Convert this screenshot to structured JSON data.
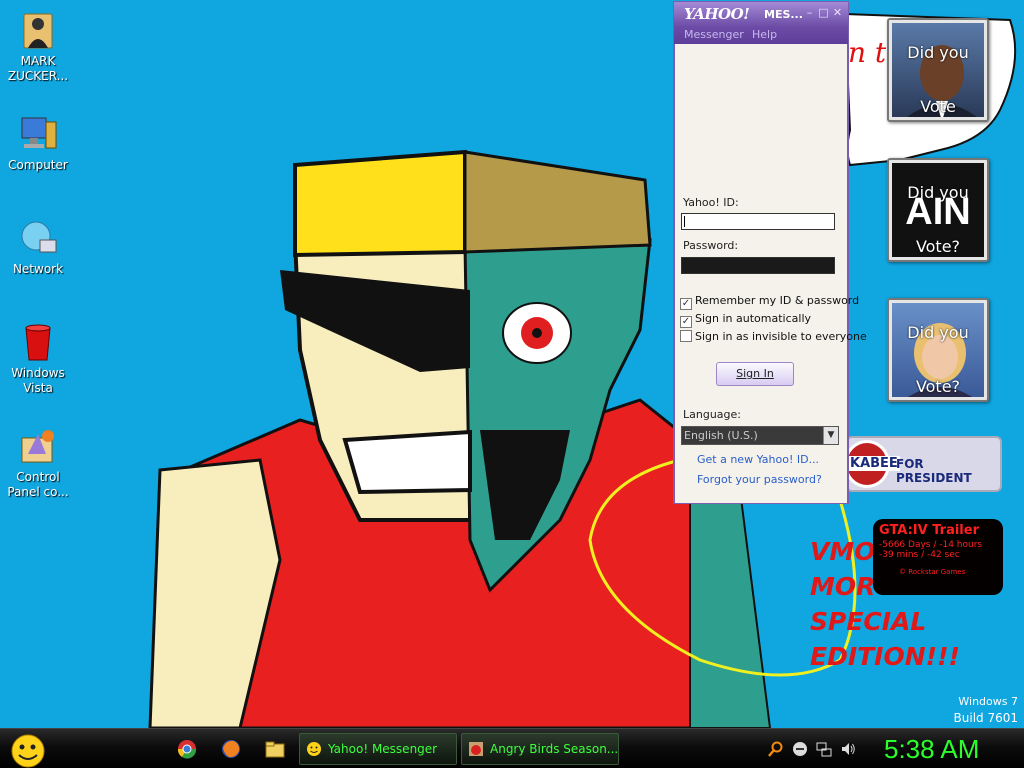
{
  "desktop": {
    "icons": [
      {
        "label_line1": "MARK",
        "label_line2": "ZUCKER..."
      },
      {
        "label_line1": "Computer",
        "label_line2": ""
      },
      {
        "label_line1": "Network",
        "label_line2": ""
      },
      {
        "label_line1": "Windows",
        "label_line2": "Vista"
      },
      {
        "label_line1": "Control",
        "label_line2": "Panel co..."
      }
    ],
    "wallpaper_text": {
      "bubble_text": "n t",
      "vmod_lines": [
        "VMO",
        "MOR",
        "SPECIAL",
        "EDITION!!!"
      ]
    },
    "gadgets": {
      "photos": [
        {
          "line1": "Did you",
          "line2": "Vote"
        },
        {
          "line1": "Did you",
          "big": "AIN",
          "line2": "Vote?"
        },
        {
          "line1": "Did you",
          "line2": "Vote?"
        }
      ],
      "banner": {
        "name": "KABEE",
        "text": "FOR PRESIDENT"
      },
      "gta": {
        "title": "GTA:IV Trailer",
        "line1": "-5666 Days / -14 hours",
        "line2": "-39 mins / -42 sec",
        "footer": "© Rockstar Games"
      }
    },
    "build": {
      "line1": "Windows 7",
      "line2": "Build 7601"
    }
  },
  "messenger": {
    "logo": "YAHOO!",
    "title_rest": "MES...",
    "menu": [
      "Messenger",
      "Help"
    ],
    "yahoo_id_label": "Yahoo! ID:",
    "password_label": "Password:",
    "checkboxes": [
      {
        "label": "Remember my ID & password",
        "checked": true
      },
      {
        "label": "Sign in automatically",
        "checked": true
      },
      {
        "label": "Sign in as invisible to everyone",
        "checked": false
      }
    ],
    "sign_in_label": "Sign In",
    "language_label": "Language:",
    "language_value": "English (U.S.)",
    "links": [
      "Get a new Yahoo! ID...",
      "Forgot your password?"
    ]
  },
  "taskbar": {
    "tasks": [
      {
        "label": "Yahoo! Messenger"
      },
      {
        "label": "Angry Birds Season..."
      }
    ],
    "clock": "5:38 AM"
  },
  "colors": {
    "desktop_bg": "#10a6e0",
    "messenger_purple": "#7c5bb4",
    "taskbar_text_green": "#3dff3d"
  }
}
